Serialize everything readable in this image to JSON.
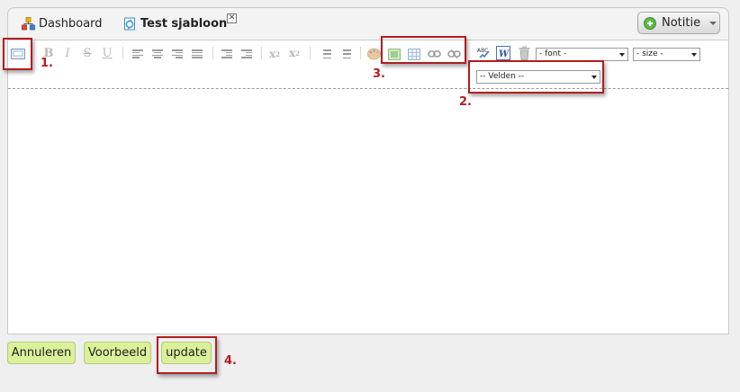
{
  "tabs": [
    {
      "label": "Dashboard",
      "icon": "dashboard-icon"
    },
    {
      "label": "Test sjabloon",
      "icon": "template-icon"
    }
  ],
  "tab_close_symbol": "✕",
  "notitie_button": {
    "label": "Notitie",
    "icon": "plus-circle-icon"
  },
  "toolbar": {
    "font_select": {
      "value": "- font -"
    },
    "size_select": {
      "value": "- size -"
    },
    "velden_select": {
      "value": "-- Velden --"
    }
  },
  "buttons": {
    "annuleren": "Annuleren",
    "voorbeeld": "Voorbeeld",
    "update": "update"
  },
  "annotations": [
    "1.",
    "2.",
    "3.",
    "4."
  ],
  "colors": {
    "accent_button": "#dbf09b",
    "annotation_red": "#b21e1e",
    "plus_green": "#5cb948"
  }
}
